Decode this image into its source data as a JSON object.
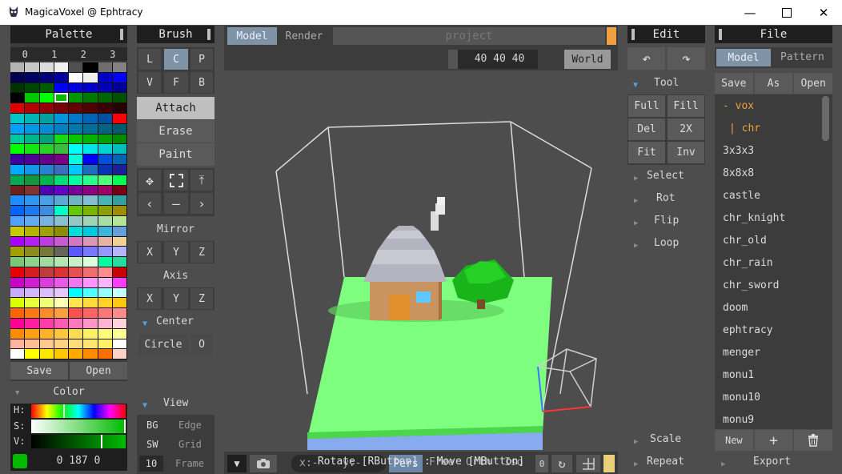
{
  "window": {
    "title": "MagicaVoxel @ Ephtracy"
  },
  "palette": {
    "title": "Palette",
    "tabs": [
      "0",
      "1",
      "2",
      "3"
    ],
    "save": "Save",
    "open": "Open",
    "colors": [
      [
        "#b4b4b4",
        "#c8c8c8",
        "#dcdcdc",
        "#f0f0f0",
        "#505050",
        "#000000",
        "#6e6e6e",
        "#828282"
      ],
      [
        "#000050",
        "#000064",
        "#000078",
        "#0000a0",
        "#ffffff",
        "#f0f0f0",
        "#0000c8",
        "#0000ff"
      ],
      [
        "#003200",
        "#004600",
        "#005a00",
        "#0000ff",
        "#0000dc",
        "#0000c8",
        "#0000b4",
        "#000096"
      ],
      [
        "#000000",
        "#00c800",
        "#00ff00",
        "#00b400",
        "#009600",
        "#007800",
        "#006400",
        "#005000"
      ],
      [
        "#dc0000",
        "#b40000",
        "#960000",
        "#780000",
        "#640000",
        "#500000",
        "#3c0000",
        "#280000"
      ],
      [
        "#00c8c8",
        "#00b4b4",
        "#00a0a0",
        "#0096dc",
        "#0078c8",
        "#0064b4",
        "#0050a0",
        "#ff0000"
      ],
      [
        "#00a0ff",
        "#0096e6",
        "#008cd2",
        "#0082be",
        "#0078aa",
        "#006e96",
        "#006482",
        "#005a6e"
      ],
      [
        "#00c8a0",
        "#00b48c",
        "#00a078",
        "#14dc14",
        "#00c800",
        "#00b400",
        "#00a000",
        "#008c00"
      ],
      [
        "#00ff00",
        "#14e614",
        "#28d228",
        "#3cbe3c",
        "#00ffff",
        "#00e6e6",
        "#00d2d2",
        "#00bebe"
      ],
      [
        "#3c00a0",
        "#500096",
        "#64008c",
        "#780082",
        "#00ffdc",
        "#0000ff",
        "#0050dc",
        "#0064b4"
      ],
      [
        "#00aaff",
        "#1496e6",
        "#2882d2",
        "#3c6ebe",
        "#00c8ff",
        "#1e6ebe",
        "#0a32b4",
        "#1e1e96"
      ],
      [
        "#00aa55",
        "#14963c",
        "#00b450",
        "#00dc78",
        "#00ffa0",
        "#28ff8c",
        "#50ff78",
        "#00ff50"
      ],
      [
        "#6e1e1e",
        "#823232",
        "#5000b4",
        "#6400c8",
        "#780096",
        "#8c0082",
        "#a00064",
        "#780014"
      ],
      [
        "#1e8cff",
        "#3296f0",
        "#46a0e1",
        "#5aaad2",
        "#6eb4c3",
        "#82bed2",
        "#46b4b4",
        "#32a0a0"
      ],
      [
        "#0064ff",
        "#1e78f0",
        "#3c8ce1",
        "#00ffc8",
        "#64c800",
        "#78b400",
        "#8ca000",
        "#a08c00"
      ],
      [
        "#50a0ff",
        "#64aaf0",
        "#78b4e1",
        "#8cbed2",
        "#96c8c3",
        "#a0d2b4",
        "#aadca5",
        "#b4e696"
      ],
      [
        "#c8c800",
        "#b4b400",
        "#a0a000",
        "#8c8c00",
        "#00dcdc",
        "#00c8dc",
        "#3cb4dc",
        "#64a0dc"
      ],
      [
        "#aa00ff",
        "#b41ef0",
        "#be3ce1",
        "#c85ad2",
        "#d278c3",
        "#dc96b4",
        "#e6b4a5",
        "#f0d296"
      ],
      [
        "#a0a000",
        "#8c8c1e",
        "#78783c",
        "#64645a",
        "#5a5aff",
        "#7878ff",
        "#9696ff",
        "#b4b4ff"
      ],
      [
        "#78c878",
        "#8cd28c",
        "#a0dca0",
        "#b4e6b4",
        "#c8f0c8",
        "#dcffdc",
        "#00ffa0",
        "#28dca0"
      ],
      [
        "#e60000",
        "#d21e1e",
        "#be3c3c",
        "#dc3232",
        "#e65050",
        "#f06e6e",
        "#ff8c8c",
        "#c80000"
      ],
      [
        "#c800c8",
        "#d21ed2",
        "#dc3cdc",
        "#e65ae6",
        "#f078f0",
        "#ff96ff",
        "#ffb4ff",
        "#ff3cff"
      ],
      [
        "#c8aaff",
        "#d2b4ff",
        "#dcbeff",
        "#e6c8ff",
        "#00ffff",
        "#50ffff",
        "#96ffff",
        "#c8ffff"
      ],
      [
        "#dcff00",
        "#e6ff3c",
        "#f0ff78",
        "#ffffb4",
        "#ffe650",
        "#ffdc3c",
        "#ffd228",
        "#ffc814"
      ],
      [
        "#ff6400",
        "#ff7814",
        "#ff8c28",
        "#ffa03c",
        "#ff5050",
        "#ff6464",
        "#ff7878",
        "#ff8c8c"
      ],
      [
        "#ff0096",
        "#ff1ea0",
        "#ff3caa",
        "#ff5ab4",
        "#ff78be",
        "#ff96c8",
        "#ffb4d2",
        "#ffd2dc"
      ],
      [
        "#ff8c00",
        "#ffa014",
        "#ffb428",
        "#ffc83c",
        "#ffdc50",
        "#fff064",
        "#ffff78",
        "#ffff96"
      ],
      [
        "#ffb4a0",
        "#ffbe96",
        "#ffc88c",
        "#ffd282",
        "#ffdc78",
        "#ffe66e",
        "#fff064",
        "#ffffff"
      ],
      [
        "#ffffff",
        "#ffff00",
        "#ffe600",
        "#ffc800",
        "#ffaa00",
        "#ff8c00",
        "#ff6e00",
        "#ffd2c8"
      ]
    ]
  },
  "color_picker": {
    "title": "Color",
    "h_label": "H:",
    "s_label": "S:",
    "v_label": "V:",
    "swatch": "#00bb00",
    "value": "0 187 0"
  },
  "brush": {
    "title": "Brush",
    "modes_row1": [
      "L",
      "C",
      "P"
    ],
    "modes_row2": [
      "V",
      "F",
      "B"
    ],
    "actions": [
      "Attach",
      "Erase",
      "Paint"
    ],
    "mirror": "Mirror",
    "axis": "Axis",
    "xyz": [
      "X",
      "Y",
      "Z"
    ],
    "center": "Center",
    "circle": "Circle",
    "circle_o": "O",
    "view": "View",
    "bg": "BG",
    "edge": "Edge",
    "sw": "SW",
    "grid": "Grid",
    "frame_value": "10",
    "frame": "Frame"
  },
  "viewport": {
    "tab_model": "Model",
    "tab_render": "Render",
    "project": "project",
    "size": "40 40 40",
    "world": "World",
    "x_coord": "x:-",
    "y_coord": "y:-",
    "pers": "Pers",
    "free": "Free",
    "orth": "Orth",
    "iso": "Iso",
    "zero": "0",
    "status": "Rotate [RButton] : Move [MButton]"
  },
  "edit": {
    "title": "Edit",
    "tool": "Tool",
    "tools": [
      [
        "Full",
        "Fill"
      ],
      [
        "Del",
        "2X"
      ],
      [
        "Fit",
        "Inv"
      ]
    ],
    "sections": [
      "Select",
      "Rot",
      "Flip",
      "Loop"
    ],
    "scale": "Scale",
    "repeat": "Repeat"
  },
  "file": {
    "title": "File",
    "tab_model": "Model",
    "tab_pattern": "Pattern",
    "save": "Save",
    "as": "As",
    "open": "Open",
    "folder": "- vox",
    "subfolder": "| chr",
    "items": [
      "3x3x3",
      "8x8x8",
      "castle",
      "chr_knight",
      "chr_old",
      "chr_rain",
      "chr_sword",
      "doom",
      "ephtracy",
      "menger",
      "monu1",
      "monu10",
      "monu9"
    ],
    "new": "New",
    "plus": "+",
    "export": "Export"
  }
}
